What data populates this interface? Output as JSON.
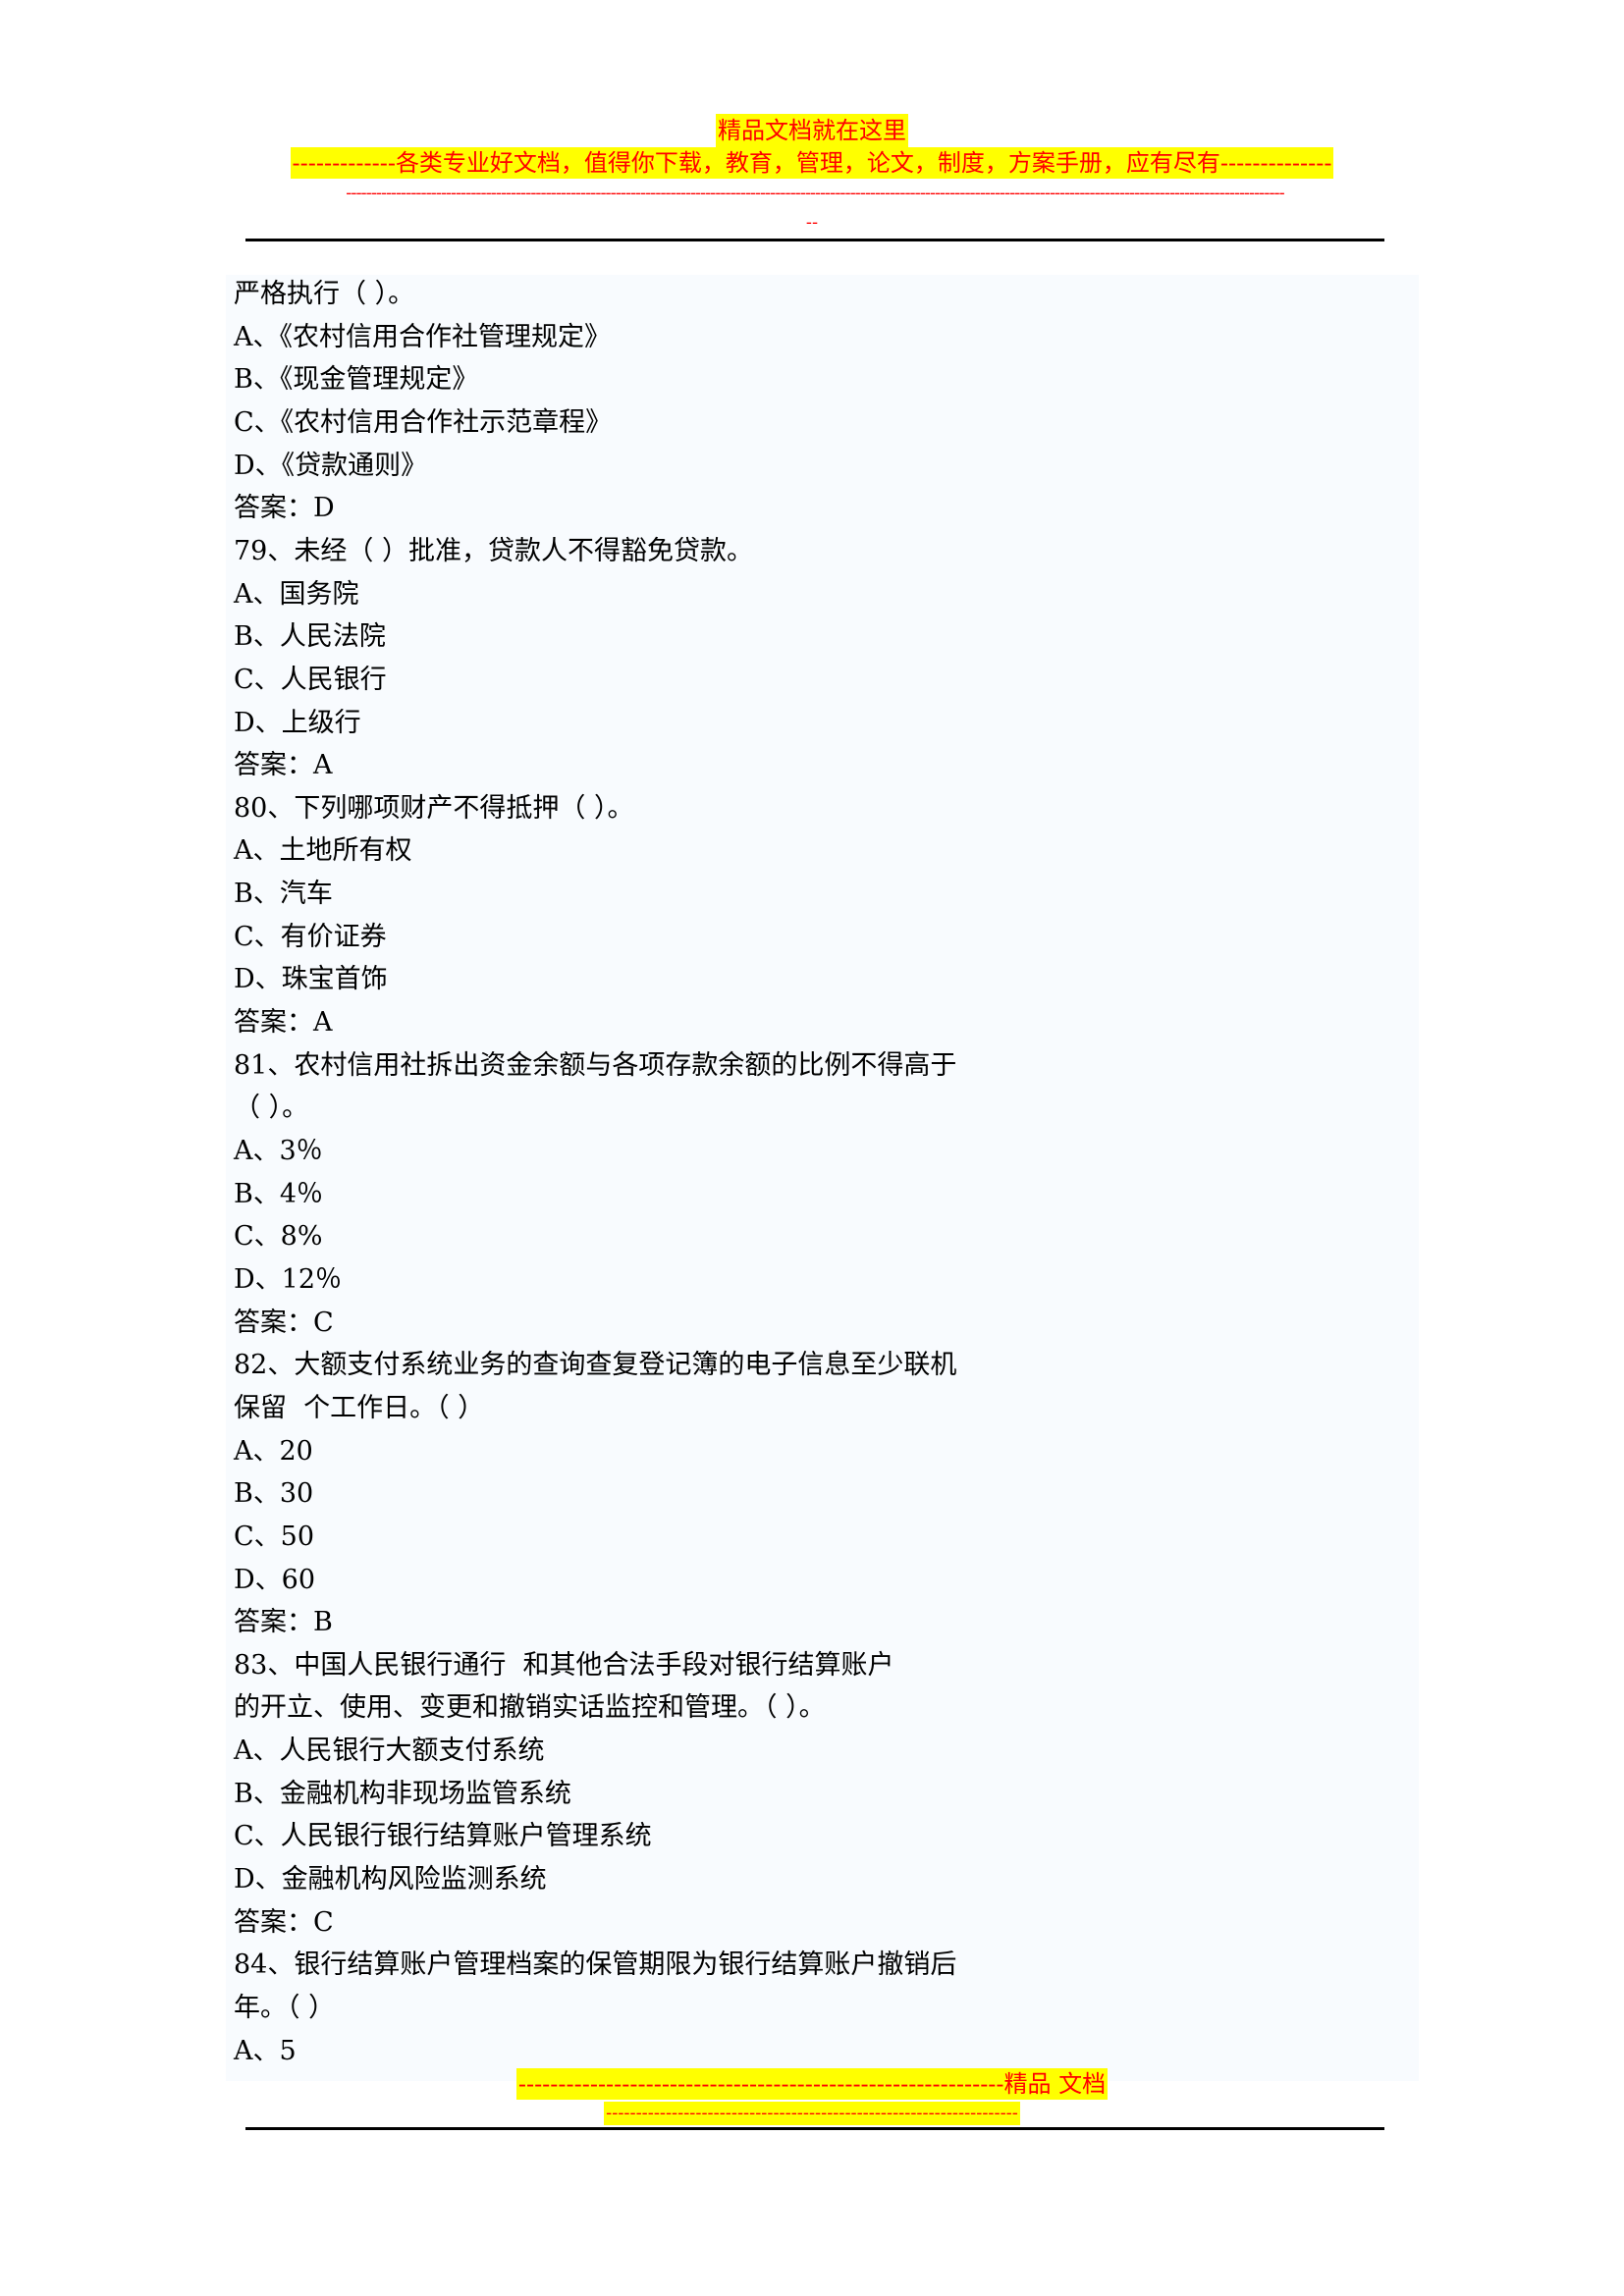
{
  "header": {
    "title": "精品文档就在这里",
    "subtitle": "-------------各类专业好文档，值得你下载，教育，管理，论文，制度，方案手册，应有尽有--------------",
    "dashes": "--------------------------------------------------------------------------------------------------------------------------------------------------------------------------------------------",
    "dashes_tail": "--"
  },
  "lines": [
    "严格执行（ ）。",
    "A、《农村信用合作社管理规定》",
    "B、《现金管理规定》",
    "C、《农村信用合作社示范章程》",
    "D、《贷款通则》",
    "答案：D",
    "79、未经（ ）批准，贷款人不得豁免贷款。",
    "A、国务院",
    "B、人民法院",
    "C、人民银行",
    "D、上级行",
    "答案：A",
    "80、下列哪项财产不得抵押（ ）。",
    "A、土地所有权",
    "B、汽车",
    "C、有价证券",
    "D、珠宝首饰",
    "答案：A",
    "81、农村信用社拆出资金余额与各项存款余额的比例不得高于",
    "（ ）。",
    "A、3％",
    "B、4％",
    "C、8%",
    "D、12％",
    "答案：C",
    "82、大额支付系统业务的查询查复登记簿的电子信息至少联机",
    "保留  个工作日。（ ）",
    "A、20",
    "B、30",
    "C、50",
    "D、60",
    "答案：B",
    "83、中国人民银行通行  和其他合法手段对银行结算账户",
    "的开立、使用、变更和撤销实话监控和管理。（ ）。",
    "A、人民银行大额支付系统",
    "B、金融机构非现场监管系统",
    "C、人民银行银行结算账户管理系统",
    "D、金融机构风险监测系统",
    "答案：C",
    "84、银行结算账户管理档案的保管期限为银行结算账户撤销后",
    "年。（ ）",
    "A、5"
  ],
  "footer": {
    "line1": "-------------------------------------------------------------精品    文档",
    "line2": "---------------------------------------------------------------------"
  },
  "colors": {
    "highlight": "#ffff00",
    "header_text": "#ff0000",
    "content_bg": "#f8fbfe"
  }
}
